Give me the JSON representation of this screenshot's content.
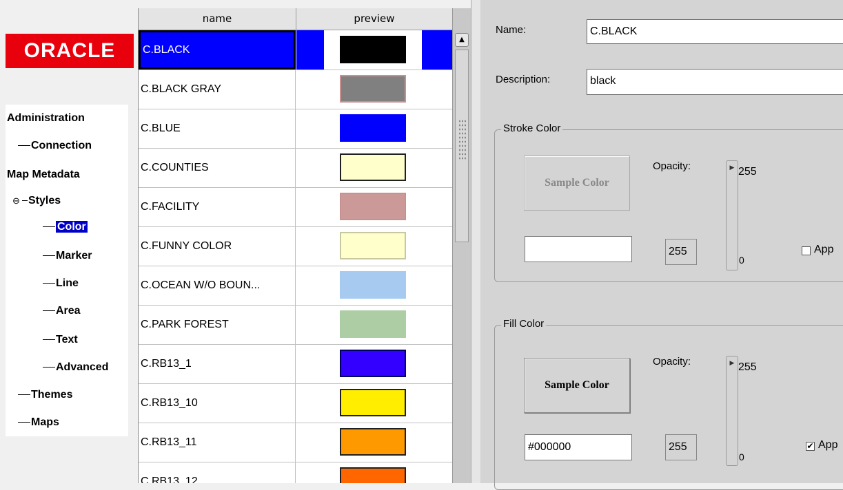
{
  "logo": {
    "text": "ORACLE"
  },
  "tree": {
    "administration": "Administration",
    "connection": "Connection",
    "map_metadata": "Map Metadata",
    "styles": "Styles",
    "color": "Color",
    "marker": "Marker",
    "line": "Line",
    "area": "Area",
    "text": "Text",
    "advanced": "Advanced",
    "themes": "Themes",
    "maps": "Maps"
  },
  "table": {
    "headers": {
      "name": "name",
      "preview": "preview"
    },
    "rows": [
      {
        "name": "C.BLACK",
        "fill": "#000000",
        "border": "#000000",
        "selected": true
      },
      {
        "name": "C.BLACK GRAY",
        "fill": "#808080",
        "border": "#c89090"
      },
      {
        "name": "C.BLUE",
        "fill": "#0000ff",
        "border": "#0000ff"
      },
      {
        "name": "C.COUNTIES",
        "fill": "#ffffcc",
        "border": "#202020"
      },
      {
        "name": "C.FACILITY",
        "fill": "#cc9999",
        "border": "#c89090"
      },
      {
        "name": "C.FUNNY COLOR",
        "fill": "#ffffcc",
        "border": "#c8c8a0"
      },
      {
        "name": "C.OCEAN W/O BOUN...",
        "fill": "#a6caf0",
        "border": "#a6caf0"
      },
      {
        "name": "C.PARK FOREST",
        "fill": "#adcda4",
        "border": "#adcda4"
      },
      {
        "name": "C.RB13_1",
        "fill": "#3300ff",
        "border": "#000066"
      },
      {
        "name": "C.RB13_10",
        "fill": "#ffee00",
        "border": "#202020"
      },
      {
        "name": "C.RB13_11",
        "fill": "#ff9900",
        "border": "#202020"
      },
      {
        "name": "C.RB13_12",
        "fill": "#ff6600",
        "border": "#202020"
      }
    ]
  },
  "form": {
    "name_label": "Name:",
    "name_value": "C.BLACK",
    "description_label": "Description:",
    "description_value": "black",
    "stroke": {
      "title": "Stroke Color",
      "sample_label": "Sample Color",
      "opacity_label": "Opacity:",
      "slider_max": "255",
      "slider_min": "0",
      "color_value": "",
      "opacity_value": "255",
      "apply_label": "App",
      "apply_checked": ""
    },
    "fill": {
      "title": "Fill Color",
      "sample_label": "Sample Color",
      "opacity_label": "Opacity:",
      "slider_max": "255",
      "slider_min": "0",
      "color_value": "#000000",
      "opacity_value": "255",
      "apply_label": "App",
      "apply_checked": "✔"
    }
  },
  "icons": {
    "scroll_up": "▲",
    "collapse": "⊖",
    "slider_knob": "▶"
  }
}
